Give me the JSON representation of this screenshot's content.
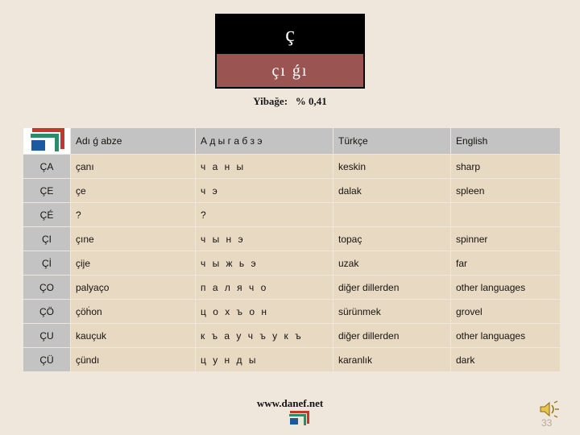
{
  "title_box": {
    "letter": "ç",
    "name": "çı ǵı"
  },
  "subtitle": {
    "label": "Yibağe:",
    "value": "% 0,41",
    "full": "Yibağe:   % 0,41"
  },
  "table": {
    "logo_icon": "danef-nested-squares-logo",
    "headers": {
      "logo": "",
      "adigabze": "Adı ǵ abze",
      "cyrillic": "А д ы г а б з э",
      "turkish": "Türkçe",
      "english": "English"
    },
    "rows": [
      {
        "key": "ÇA",
        "adigabze": "çanı",
        "cyrillic": "ч а н ы",
        "turkish": "keskin",
        "english": "sharp"
      },
      {
        "key": "ÇE",
        "adigabze": "çe",
        "cyrillic": "ч э",
        "turkish": "dalak",
        "english": "spleen"
      },
      {
        "key": "ÇÉ",
        "adigabze": "?",
        "cyrillic": "?",
        "turkish": "",
        "english": ""
      },
      {
        "key": "ÇI",
        "adigabze": "çıne",
        "cyrillic": "ч ы н э",
        "turkish": "topaç",
        "english": "spinner"
      },
      {
        "key": "Çİ",
        "adigabze": "çije",
        "cyrillic": "ч ы ж ь э",
        "turkish": "uzak",
        "english": "far"
      },
      {
        "key": "ÇO",
        "adigabze": "palyaço",
        "cyrillic": "п а л я ч о",
        "turkish": "diğer dillerden",
        "english": "other languages"
      },
      {
        "key": "ÇÖ",
        "adigabze": "çöḣon",
        "cyrillic": "ц о х ъ о н",
        "turkish": "sürünmek",
        "english": "grovel"
      },
      {
        "key": "ÇU",
        "adigabze": "kauçuk",
        "cyrillic": "к ъ а у ч ъ у к ъ",
        "turkish": "diğer dillerden",
        "english": "other languages"
      },
      {
        "key": "ÇÜ",
        "adigabze": "çündı",
        "cyrillic": "ц у н д ы",
        "turkish": "karanlık",
        "english": "dark"
      }
    ]
  },
  "footer": {
    "url": "www.danef.net",
    "logo_icon": "danef-nested-squares-logo",
    "sound_icon": "speaker-icon",
    "page_number": "33"
  },
  "colors": {
    "background": "#efe6dc",
    "flag_top": "#000000",
    "flag_bottom": "#9a5552",
    "header_row": "#c3c3c3",
    "data_row": "#e8d9c3",
    "logo_red": "#c0392b",
    "logo_green": "#2e8b6a",
    "logo_blue": "#1c5aa0"
  }
}
